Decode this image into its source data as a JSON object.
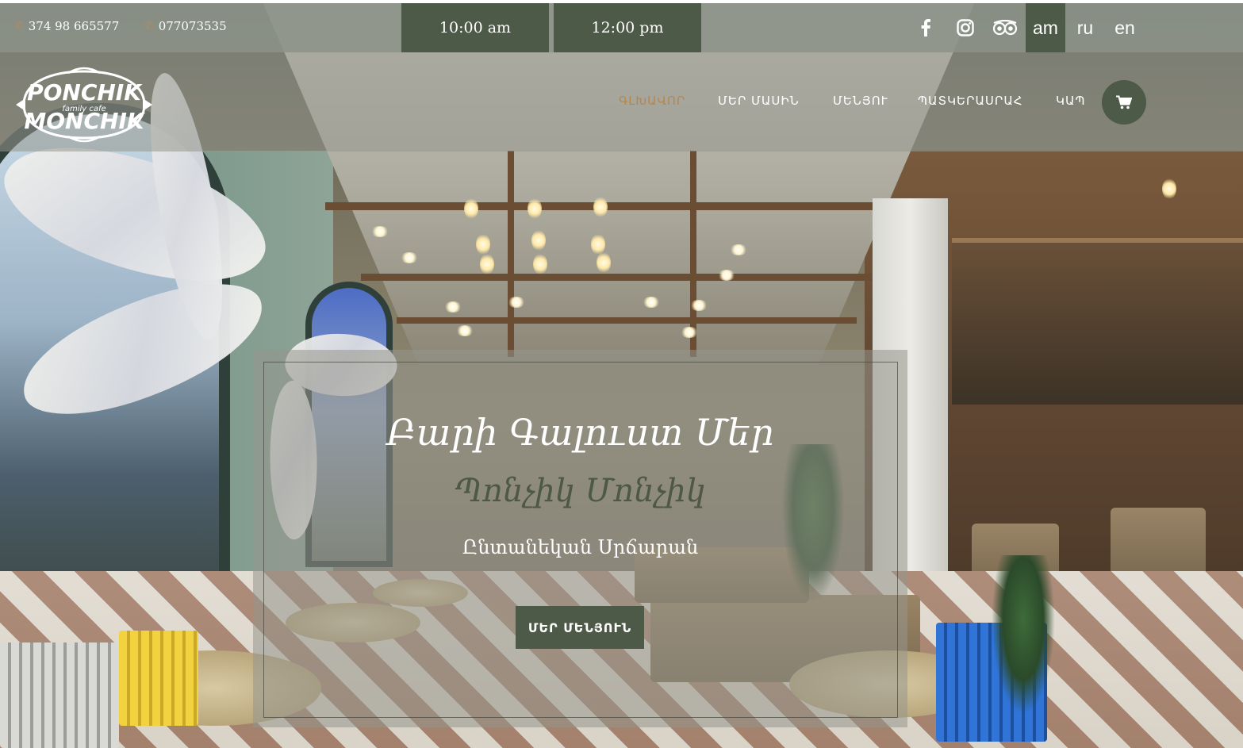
{
  "topbar": {
    "phones": [
      "374 98 665577",
      "077073535"
    ],
    "hours": [
      "10:00 am",
      "12:00 pm"
    ],
    "social": [
      "facebook-icon",
      "instagram-icon",
      "tripadvisor-icon"
    ],
    "languages": [
      {
        "code": "am",
        "active": true
      },
      {
        "code": "ru",
        "active": false
      },
      {
        "code": "en",
        "active": false
      }
    ]
  },
  "logo": {
    "top": "PONCHIK",
    "middle": "family cafe",
    "bottom": "MONCHIK"
  },
  "nav": {
    "items": [
      {
        "label": "ԳԼԽԱՎՈՐ",
        "active": true
      },
      {
        "label": "ՄԵՐ ՄԱՍԻՆ",
        "active": false
      },
      {
        "label": "ՄԵՆՅՈՒ",
        "active": false
      },
      {
        "label": "ՊԱՏԿԵՐԱՍՐԱՀ",
        "active": false
      },
      {
        "label": "ԿԱՊ",
        "active": false
      }
    ],
    "cart_icon": "shopping-cart-icon"
  },
  "hero": {
    "title": "Բարի Գալուստ Մեր",
    "subtitle": "Պոնչիկ Մոնչիկ",
    "tagline": "Ընտանեկան Սրճարան",
    "cta_label": "ՄԵՐ ՄԵՆՅՈՒՆ"
  },
  "colors": {
    "accent": "#4d5a47",
    "active_nav": "#b5874f",
    "phone_icon": "#b58a5e"
  }
}
